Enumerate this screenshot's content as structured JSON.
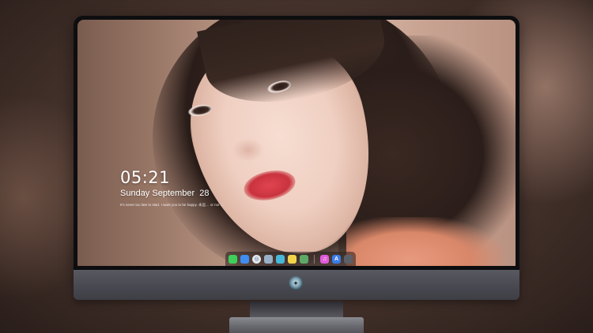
{
  "lock_screen": {
    "time": "05:21",
    "date": "Sunday September  28",
    "quote": "It's never too late to start. I want you to be happy. 永远… or not …"
  },
  "dock": {
    "apps": [
      {
        "name": "messages",
        "icon": "■",
        "color": "#3ecf5a"
      },
      {
        "name": "finder",
        "icon": "■",
        "color": "#3f8df0"
      },
      {
        "name": "safari",
        "icon": "◎",
        "color": "#e8e8ea"
      },
      {
        "name": "preview",
        "icon": "■",
        "color": "#9ab0c8"
      },
      {
        "name": "claquette",
        "icon": "■",
        "color": "#48b8d8"
      },
      {
        "name": "notes",
        "icon": "■",
        "color": "#f2d24b"
      },
      {
        "name": "photos-viewer",
        "icon": "■",
        "color": "#5ea867"
      },
      {
        "name": "itunes",
        "icon": "♫",
        "color": "#e05bd8"
      },
      {
        "name": "app-store",
        "icon": "A",
        "color": "#3a7de8"
      },
      {
        "name": "camera",
        "icon": "■",
        "color": "#5b5f66"
      }
    ]
  },
  "monitor": {
    "chin_logo": "logo-icon"
  }
}
